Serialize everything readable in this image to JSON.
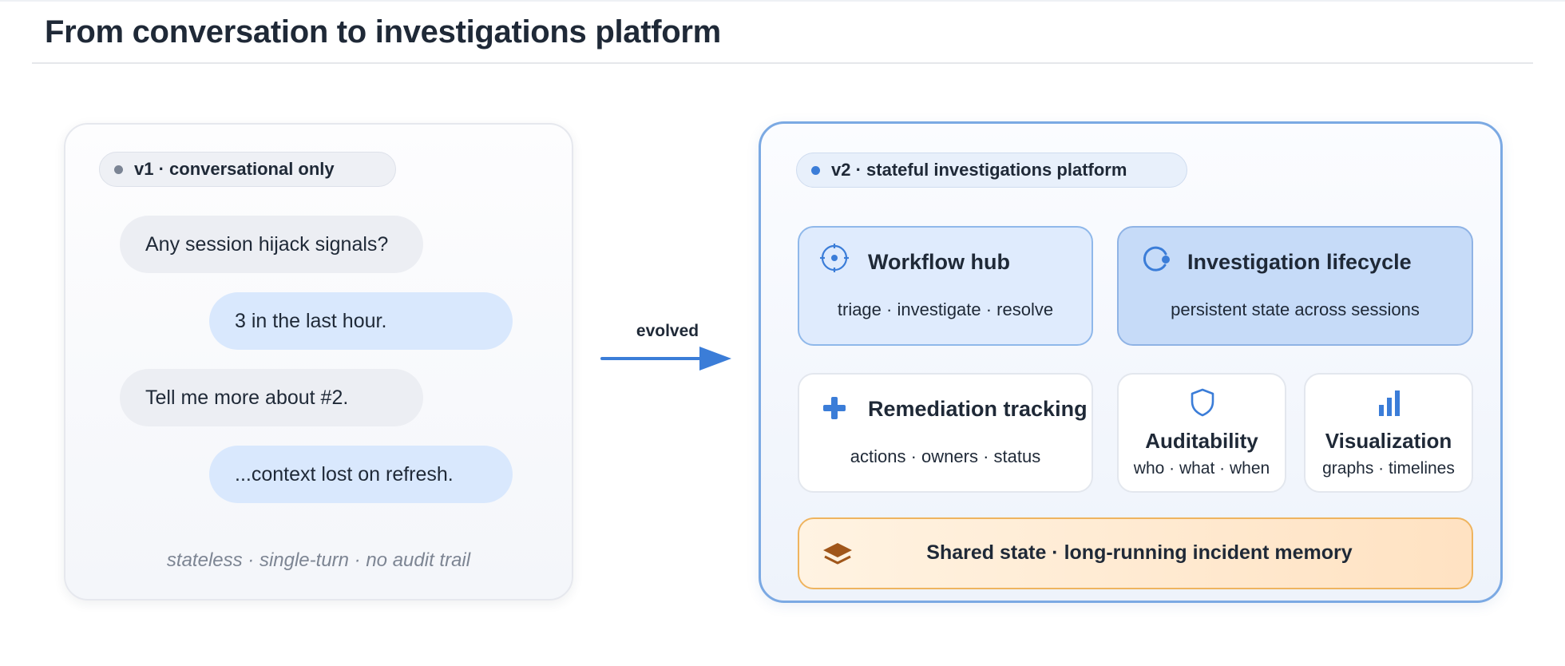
{
  "page": {
    "title": "From conversation to investigations platform"
  },
  "v1": {
    "badge": "v1 · conversational only",
    "messages": [
      {
        "role": "user",
        "text": "Any session hijack signals?"
      },
      {
        "role": "assistant",
        "text": "3 in the last hour."
      },
      {
        "role": "user",
        "text": "Tell me more about #2."
      },
      {
        "role": "assistant",
        "text": "...context lost on refresh."
      }
    ],
    "caption": "stateless · single-turn · no audit trail"
  },
  "transition": {
    "label": "evolved"
  },
  "v2": {
    "badge": "v2 · stateful investigations platform",
    "cards": {
      "workflow": {
        "title": "Workflow hub",
        "subtitle": "triage · investigate · resolve",
        "icon": "crosshair-icon"
      },
      "lifecycle": {
        "title": "Investigation lifecycle",
        "subtitle": "persistent state across sessions",
        "icon": "cycle-icon"
      },
      "remediation": {
        "title": "Remediation tracking",
        "subtitle": "actions · owners · status",
        "icon": "plus-icon"
      },
      "auditability": {
        "title": "Auditability",
        "subtitle": "who · what · when",
        "icon": "shield-icon"
      },
      "visualization": {
        "title": "Visualization",
        "subtitle": "graphs · timelines",
        "icon": "bar-chart-icon"
      },
      "shared": {
        "title": "Shared state · long-running incident memory",
        "icon": "layers-icon"
      }
    }
  },
  "colors": {
    "accent_blue": "#3b7dd8",
    "v1_dot": "#7b8494",
    "v2_border": "#7ba9e3",
    "layers_brown": "#a0561a",
    "shared_border": "#efb45f"
  }
}
